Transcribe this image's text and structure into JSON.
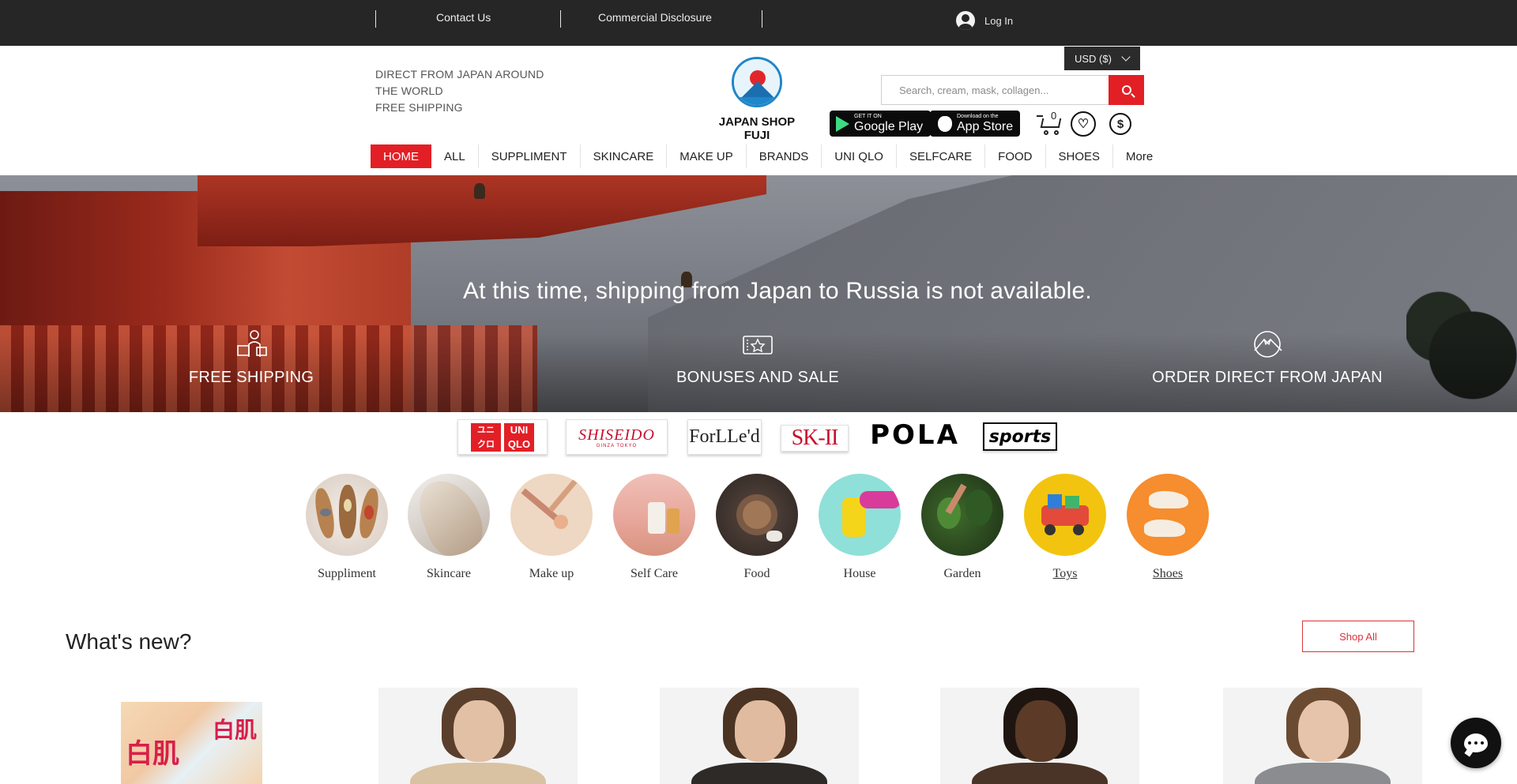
{
  "topbar": {
    "contact_label": "Contact Us",
    "disclosure_label": "Commercial Disclosure",
    "login_label": "Log In"
  },
  "header": {
    "tagline_line1": "DIRECT FROM JAPAN AROUND",
    "tagline_line2": "THE WORLD",
    "tagline_line3": "FREE SHIPPING",
    "logo_text": "JAPAN SHOP FUJI",
    "currency": "USD ($)",
    "search_placeholder": "Search, cream, mask, collagen...",
    "google_play_small": "GET IT ON",
    "google_play_big": "Google Play",
    "app_store_small": "Download on the",
    "app_store_big": "App Store",
    "cart_count": "0"
  },
  "nav": {
    "items": [
      {
        "label": "HOME",
        "active": true
      },
      {
        "label": "ALL"
      },
      {
        "label": "SUPPLIMENT"
      },
      {
        "label": "SKINCARE"
      },
      {
        "label": "MAKE UP"
      },
      {
        "label": "BRANDS"
      },
      {
        "label": "UNI QLO"
      },
      {
        "label": "SELFCARE"
      },
      {
        "label": "FOOD"
      },
      {
        "label": "SHOES"
      },
      {
        "label": "More"
      }
    ]
  },
  "hero": {
    "message": "At this time, shipping from Japan to Russia is not available.",
    "features": [
      {
        "label": "FREE SHIPPING",
        "icon": "delivery-person-icon"
      },
      {
        "label": "BONUSES AND SALE",
        "icon": "ticket-star-icon"
      },
      {
        "label": "ORDER DIRECT FROM JAPAN",
        "icon": "fuji-mountain-icon"
      }
    ]
  },
  "brands": {
    "uniqlo_top": "ユニ",
    "uniqlo_top2": "クロ",
    "uniqlo_a": "UNI",
    "uniqlo_b": "QLO",
    "shiseido": "SHISEIDO",
    "shiseido_sub": "GINZA TOKYO",
    "forlled": "ForLLe'd",
    "skii": "SK-II",
    "pola": "POLA",
    "sports": "sports"
  },
  "categories": [
    {
      "label": "Suppliment"
    },
    {
      "label": "Skincare"
    },
    {
      "label": "Make up"
    },
    {
      "label": "Self Care"
    },
    {
      "label": "Food"
    },
    {
      "label": "House"
    },
    {
      "label": "Garden"
    },
    {
      "label": "Toys"
    },
    {
      "label": "Shoes"
    }
  ],
  "whats_new": {
    "title": "What's new?",
    "shop_all": "Shop All",
    "product_text_1": "白肌",
    "product_text_2": "白肌"
  },
  "colors": {
    "accent_red": "#e31f26",
    "topbar_bg": "#262626"
  }
}
